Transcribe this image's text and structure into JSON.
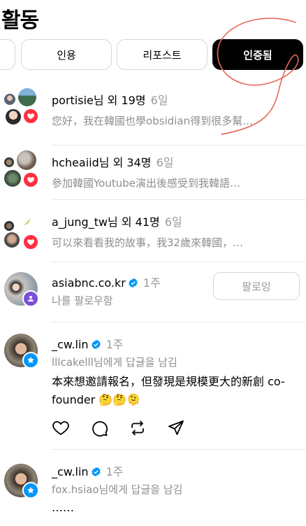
{
  "header": {
    "title": "활동"
  },
  "tabs": [
    {
      "label": ""
    },
    {
      "label": "인용"
    },
    {
      "label": "리포스트"
    },
    {
      "label": "인증됨"
    }
  ],
  "notifications": [
    {
      "username": "portisie",
      "suffix": "님 외 19명",
      "time": "6일",
      "preview": "您好，我在韓國也學obsidian得到很多幫…",
      "badge": "heart-icon"
    },
    {
      "username": "hcheaiid",
      "suffix": "님 외 34명",
      "time": "6일",
      "preview": "參加韓國Youtube演出後感受到我韓語…",
      "badge": "heart-icon"
    },
    {
      "username": "a_jung_tw",
      "suffix": "님 외 41명",
      "time": "6일",
      "preview": "可以來看看我的故事，我32歲來韓國，…",
      "badge": "heart-icon"
    },
    {
      "username": "asiabnc.co.kr",
      "time": "1주",
      "preview": "나를 팔로우함",
      "button": "팔로잉",
      "badge": "person-icon"
    },
    {
      "username": "_cw.lin",
      "time": "1주",
      "preview": "lllcakelll님에게 답글을 남김",
      "body": "本來想邀請報名，但發現是規模更大的新創 co-founder 🤔🤔🫠",
      "badge": "star-icon"
    },
    {
      "username": "_cw.lin",
      "time": "1주",
      "preview": "fox.hsiao님에게 답글을 남김",
      "body": "……",
      "badge": "star-icon"
    }
  ],
  "colors": {
    "heart_badge": "#ff3040",
    "follow_badge": "#7b4fd6",
    "reply_badge": "#0095f6",
    "verified": "#0095f6",
    "muted_text": "#8e8e8e",
    "scribble": "#e8675a"
  }
}
